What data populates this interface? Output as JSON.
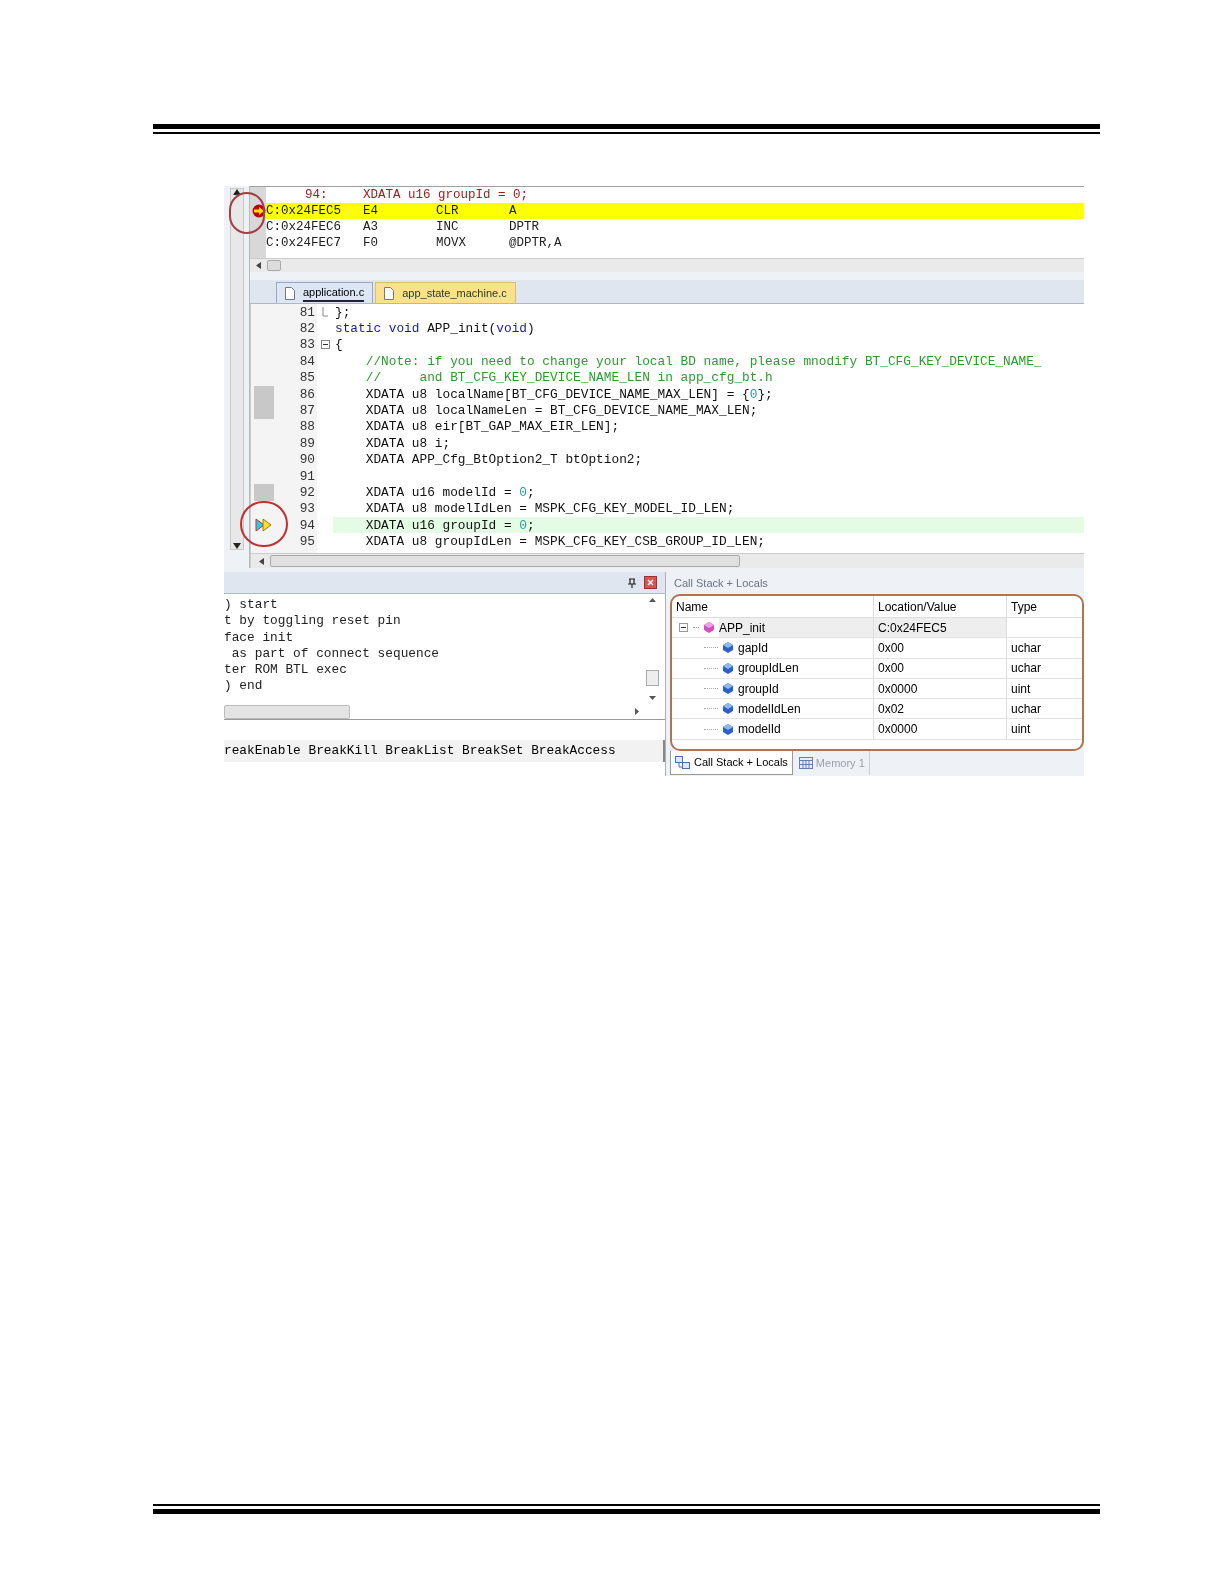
{
  "disassembly": {
    "source_line": {
      "number": "94:",
      "code": "XDATA u16 groupId = 0;"
    },
    "rows": [
      {
        "address": "C:0x24FEC5",
        "opcode": "E4",
        "mnemonic": "CLR",
        "operand": "A",
        "current": true
      },
      {
        "address": "C:0x24FEC6",
        "opcode": "A3",
        "mnemonic": "INC",
        "operand": "DPTR",
        "current": false
      },
      {
        "address": "C:0x24FEC7",
        "opcode": "F0",
        "mnemonic": "MOVX",
        "operand": "@DPTR,A",
        "current": false
      }
    ]
  },
  "editor_tabs": [
    {
      "label": "application.c",
      "selected": true
    },
    {
      "label": "app_state_machine.c",
      "selected": false
    }
  ],
  "code_lines": [
    {
      "number": "81",
      "fold_start": false,
      "fold_end": true,
      "marked": false,
      "current": false,
      "parts": [
        {
          "text": "};",
          "kind": "plain"
        }
      ]
    },
    {
      "number": "82",
      "fold_start": false,
      "fold_end": false,
      "marked": false,
      "current": false,
      "parts": [
        {
          "text": "static void",
          "kind": "keyword"
        },
        {
          "text": " APP_init(",
          "kind": "plain"
        },
        {
          "text": "void",
          "kind": "keyword"
        },
        {
          "text": ")",
          "kind": "plain"
        }
      ]
    },
    {
      "number": "83",
      "fold_start": true,
      "fold_end": false,
      "marked": false,
      "current": false,
      "parts": [
        {
          "text": "{",
          "kind": "plain"
        }
      ]
    },
    {
      "number": "84",
      "fold_start": false,
      "fold_end": false,
      "marked": false,
      "current": false,
      "parts": [
        {
          "text": "    //Note: if you need to change your local BD name, please mnodify BT_CFG_KEY_DEVICE_NAME_",
          "kind": "comment"
        }
      ]
    },
    {
      "number": "85",
      "fold_start": false,
      "fold_end": false,
      "marked": false,
      "current": false,
      "parts": [
        {
          "text": "    //     and BT_CFG_KEY_DEVICE_NAME_LEN in app_cfg_bt.h",
          "kind": "comment"
        }
      ]
    },
    {
      "number": "86",
      "fold_start": false,
      "fold_end": false,
      "marked": true,
      "current": false,
      "parts": [
        {
          "text": "    XDATA u8 localName[BT_CFG_DEVICE_NAME_MAX_LEN] = {",
          "kind": "plain"
        },
        {
          "text": "0",
          "kind": "number"
        },
        {
          "text": "};",
          "kind": "plain"
        }
      ]
    },
    {
      "number": "87",
      "fold_start": false,
      "fold_end": false,
      "marked": true,
      "current": false,
      "parts": [
        {
          "text": "    XDATA u8 localNameLen = BT_CFG_DEVICE_NAME_MAX_LEN;",
          "kind": "plain"
        }
      ]
    },
    {
      "number": "88",
      "fold_start": false,
      "fold_end": false,
      "marked": false,
      "current": false,
      "parts": [
        {
          "text": "    XDATA u8 eir[BT_GAP_MAX_EIR_LEN];",
          "kind": "plain"
        }
      ]
    },
    {
      "number": "89",
      "fold_start": false,
      "fold_end": false,
      "marked": false,
      "current": false,
      "parts": [
        {
          "text": "    XDATA u8 i;",
          "kind": "plain"
        }
      ]
    },
    {
      "number": "90",
      "fold_start": false,
      "fold_end": false,
      "marked": false,
      "current": false,
      "parts": [
        {
          "text": "    XDATA APP_Cfg_BtOption2_T btOption2;",
          "kind": "plain"
        }
      ]
    },
    {
      "number": "91",
      "fold_start": false,
      "fold_end": false,
      "marked": false,
      "current": false
    },
    {
      "number": "92",
      "fold_start": false,
      "fold_end": false,
      "marked": true,
      "current": false,
      "parts": [
        {
          "text": "    XDATA u16 modelId = ",
          "kind": "plain"
        },
        {
          "text": "0",
          "kind": "number"
        },
        {
          "text": ";",
          "kind": "plain"
        }
      ]
    },
    {
      "number": "93",
      "fold_start": false,
      "fold_end": false,
      "marked": false,
      "current": false,
      "parts": [
        {
          "text": "    XDATA u8 modelIdLen = MSPK_CFG_KEY_MODEL_ID_LEN;",
          "kind": "plain"
        }
      ]
    },
    {
      "number": "94",
      "fold_start": false,
      "fold_end": false,
      "marked": false,
      "current": true,
      "parts": [
        {
          "text": "    XDATA u16 groupId = ",
          "kind": "plain"
        },
        {
          "text": "0",
          "kind": "number"
        },
        {
          "text": ";",
          "kind": "plain"
        }
      ]
    },
    {
      "number": "95",
      "fold_start": false,
      "fold_end": false,
      "marked": false,
      "current": false,
      "parts": [
        {
          "text": "    XDATA u8 groupIdLen = MSPK_CFG_KEY_CSB_GROUP_ID_LEN;",
          "kind": "plain"
        }
      ]
    }
  ],
  "output_pane": {
    "lines": [
      ") start",
      "t by toggling reset pin",
      "face init",
      " as part of connect sequence",
      "ter ROM BTL exec",
      ") end"
    ],
    "command_line": "reakEnable BreakKill BreakList BreakSet BreakAccess"
  },
  "locals_pane": {
    "title": "Call Stack + Locals",
    "columns": [
      "Name",
      "Location/Value",
      "Type"
    ],
    "rows": [
      {
        "name": "APP_init",
        "value": "C:0x24FEC5",
        "kind": "function",
        "expanded": true,
        "children": [
          {
            "name": "gapId",
            "value": "0x00",
            "type": "uchar",
            "kind": "variable"
          },
          {
            "name": "groupIdLen",
            "value": "0x00",
            "type": "uchar",
            "kind": "variable"
          },
          {
            "name": "groupId",
            "value": "0x0000",
            "type": "uint",
            "kind": "variable"
          },
          {
            "name": "modelIdLen",
            "value": "0x02",
            "type": "uchar",
            "kind": "variable"
          },
          {
            "name": "modelId",
            "value": "0x0000",
            "type": "uint",
            "kind": "variable"
          }
        ]
      }
    ],
    "tabs": [
      {
        "label": "Call Stack + Locals",
        "selected": true
      },
      {
        "label": "Memory 1",
        "selected": false
      }
    ]
  }
}
